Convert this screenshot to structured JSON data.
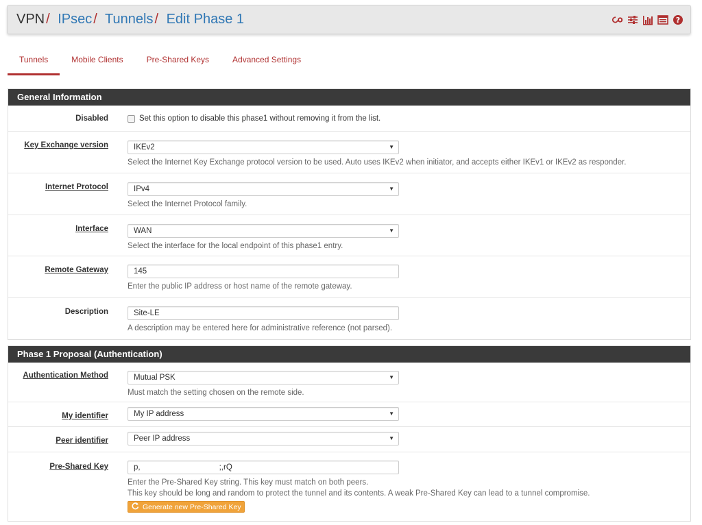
{
  "header": {
    "breadcrumb": [
      "VPN",
      "IPsec",
      "Tunnels",
      "Edit Phase 1"
    ],
    "separator": "/",
    "icons": [
      "reload-stop-icon",
      "sliders-icon",
      "bar-chart-icon",
      "list-window-icon",
      "help-icon"
    ],
    "accent_color": "#b03030",
    "link_color": "#3178b5"
  },
  "tabs": [
    {
      "label": "Tunnels",
      "active": true
    },
    {
      "label": "Mobile Clients",
      "active": false
    },
    {
      "label": "Pre-Shared Keys",
      "active": false
    },
    {
      "label": "Advanced Settings",
      "active": false
    }
  ],
  "general": {
    "heading": "General Information",
    "disabled": {
      "label": "Disabled",
      "checkbox_text": "Set this option to disable this phase1 without removing it from the list.",
      "checked": false
    },
    "key_exchange": {
      "label": "Key Exchange version",
      "value": "IKEv2",
      "help": "Select the Internet Key Exchange protocol version to be used. Auto uses IKEv2 when initiator, and accepts either IKEv1 or IKEv2 as responder."
    },
    "internet_protocol": {
      "label": "Internet Protocol",
      "value": "IPv4",
      "help": "Select the Internet Protocol family."
    },
    "interface": {
      "label": "Interface",
      "value": "WAN",
      "help": "Select the interface for the local endpoint of this phase1 entry."
    },
    "remote_gateway": {
      "label": "Remote Gateway",
      "value": "145",
      "help": "Enter the public IP address or host name of the remote gateway."
    },
    "description": {
      "label": "Description",
      "value": "Site-LE",
      "help": "A description may be entered here for administrative reference (not parsed)."
    }
  },
  "proposal": {
    "heading": "Phase 1 Proposal (Authentication)",
    "auth_method": {
      "label": "Authentication Method",
      "value": "Mutual PSK",
      "help": "Must match the setting chosen on the remote side."
    },
    "my_identifier": {
      "label": "My identifier",
      "value": "My IP address"
    },
    "peer_identifier": {
      "label": "Peer identifier",
      "value": "Peer IP address"
    },
    "psk": {
      "label": "Pre-Shared Key",
      "value": "p,                                    ;,rQ",
      "help1": "Enter the Pre-Shared Key string. This key must match on both peers.",
      "help2": "This key should be long and random to protect the tunnel and its contents. A weak Pre-Shared Key can lead to a tunnel compromise.",
      "generate_button": "Generate new Pre-Shared Key"
    }
  }
}
